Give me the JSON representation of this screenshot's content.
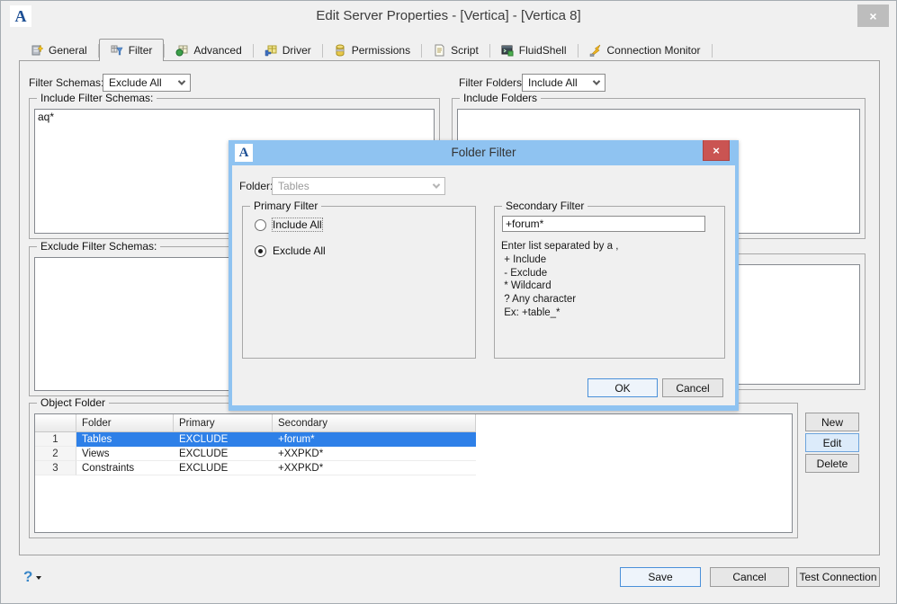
{
  "window": {
    "title": "Edit Server Properties - [Vertica] - [Vertica 8]",
    "close": "×"
  },
  "tabs": [
    {
      "label": "General"
    },
    {
      "label": "Filter"
    },
    {
      "label": "Advanced"
    },
    {
      "label": "Driver"
    },
    {
      "label": "Permissions"
    },
    {
      "label": "Script"
    },
    {
      "label": "FluidShell"
    },
    {
      "label": "Connection Monitor"
    }
  ],
  "filters": {
    "schemas_label": "Filter Schemas:",
    "schemas_value": "Exclude All",
    "folders_label": "Filter Folders:",
    "folders_value": "Include All",
    "include_schemas_title": "Include Filter Schemas:",
    "include_schemas_text": "aq*",
    "exclude_schemas_title": "Exclude Filter Schemas:",
    "include_folders_title": "Include Folders",
    "object_folder_title": "Object Folder"
  },
  "table": {
    "headers": [
      "",
      "Folder",
      "Primary",
      "Secondary"
    ],
    "rows": [
      {
        "num": "1",
        "folder": "Tables",
        "primary": "EXCLUDE",
        "secondary": "+forum*",
        "selected": true
      },
      {
        "num": "2",
        "folder": "Views",
        "primary": "EXCLUDE",
        "secondary": "+XXPKD*",
        "selected": false
      },
      {
        "num": "3",
        "folder": "Constraints",
        "primary": "EXCLUDE",
        "secondary": "+XXPKD*",
        "selected": false
      }
    ]
  },
  "side_buttons": {
    "new": "New",
    "edit": "Edit",
    "delete": "Delete"
  },
  "modal": {
    "title": "Folder Filter",
    "close": "×",
    "folder_label": "Folder:",
    "folder_value": "Tables",
    "primary": {
      "title": "Primary Filter",
      "option1": "Include All",
      "option2": "Exclude All",
      "selected": "Exclude All"
    },
    "secondary": {
      "title": "Secondary Filter",
      "value": "+forum*",
      "help": [
        "Enter list separated by a ,",
        " + Include",
        " - Exclude",
        " * Wildcard",
        " ? Any character",
        " Ex: +table_*"
      ]
    },
    "ok": "OK",
    "cancel": "Cancel"
  },
  "footer": {
    "help": "?",
    "save": "Save",
    "cancel": "Cancel",
    "test": "Test Connection"
  },
  "colors": {
    "selection_blue": "#2e80e8",
    "modal_titlebar_blue": "#8fc3f1",
    "modal_close_red": "#ca5452",
    "focus_border_blue": "#4a90d9",
    "window_bg": "#f0f0f0"
  }
}
